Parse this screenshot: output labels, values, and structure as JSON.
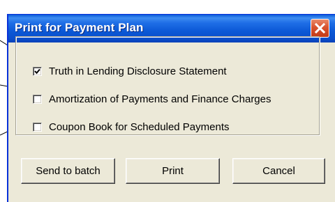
{
  "window": {
    "title": "Print for Payment Plan"
  },
  "options": [
    {
      "label": "Truth in Lending Disclosure Statement",
      "checked": true
    },
    {
      "label": "Amortization of Payments and Finance Charges",
      "checked": false
    },
    {
      "label": "Coupon Book for Scheduled Payments",
      "checked": false
    }
  ],
  "buttons": {
    "send_to_batch": "Send to batch",
    "print": "Print",
    "cancel": "Cancel"
  },
  "icons": {
    "close": "close-icon",
    "checkmark": "checkmark-icon"
  },
  "colors": {
    "titlebar": "#0a5ad8",
    "close_button": "#d9532e",
    "dialog_background": "#ece9d8"
  }
}
